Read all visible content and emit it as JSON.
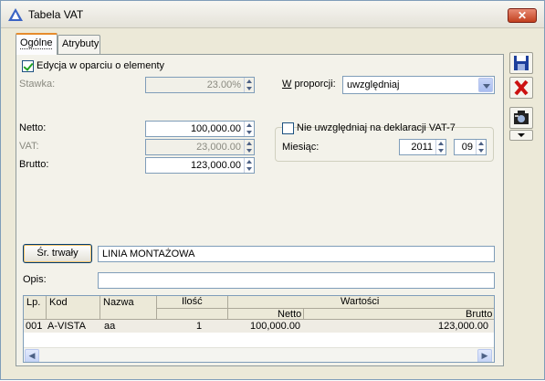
{
  "window": {
    "title": "Tabela VAT",
    "close_glyph": "✕"
  },
  "tabs": [
    {
      "label": "Ogólne"
    },
    {
      "label": "Atrybuty"
    }
  ],
  "form": {
    "edycja_label": "Edycja w oparciu o elementy",
    "edycja_checked": true,
    "stawka_label": "Stawka:",
    "stawka_value": "23.00%",
    "w_proporcji_label": "W proporcji:",
    "w_proporcji_value": "uwzględniaj",
    "netto_label": "Netto:",
    "netto_value": "100,000.00",
    "vat_label": "VAT:",
    "vat_value": "23,000.00",
    "brutto_label": "Brutto:",
    "brutto_value": "123,000.00",
    "nie_uwzgledniaj_label": "Nie uwzględniaj na deklaracji VAT-7",
    "nie_uwzgledniaj_checked": false,
    "miesiac_label": "Miesiąc:",
    "year_value": "2011",
    "month_value": "09",
    "sr_trwaly_button": "Śr. trwały",
    "sr_trwaly_value": "LINIA MONTAŻOWA",
    "opis_label": "Opis:",
    "opis_value": ""
  },
  "table": {
    "headers": {
      "lp": "Lp.",
      "kod": "Kod",
      "nazwa": "Nazwa",
      "ilosc": "Ilość",
      "wartosci": "Wartości",
      "netto": "Netto",
      "brutto": "Brutto"
    },
    "rows": [
      {
        "lp": "001",
        "kod": "A-VISTA",
        "nazwa": "aa",
        "ilosc": "1",
        "netto": "100,000.00",
        "brutto": "123,000.00"
      }
    ]
  },
  "side_buttons": [
    {
      "icon": "save-icon"
    },
    {
      "icon": "cancel-icon"
    },
    {
      "icon": "camera-icon"
    },
    {
      "icon": "dropdown-icon"
    }
  ],
  "colors": {
    "accent_tab": "#e68b2c",
    "cancel_red": "#cc1111",
    "save_blue": "#1d3f9c"
  }
}
